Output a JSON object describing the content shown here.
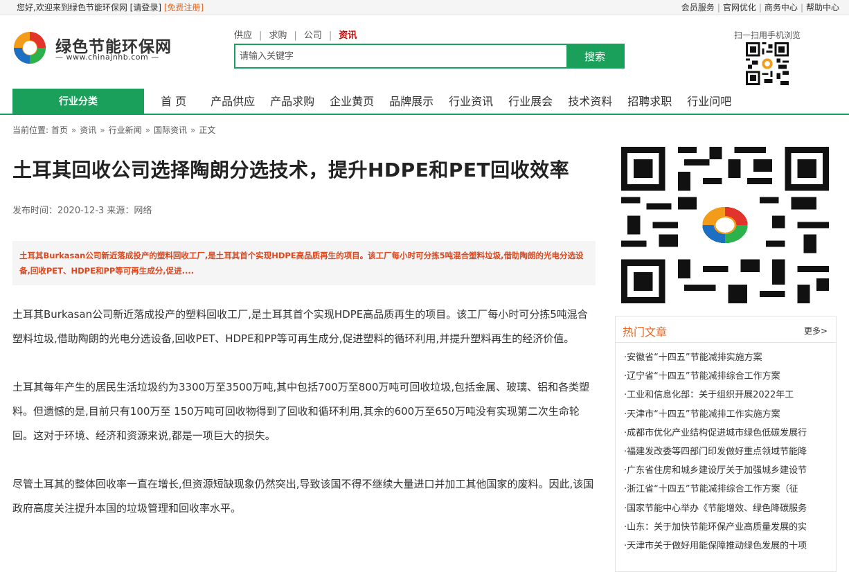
{
  "topbar": {
    "welcome": "您好,欢迎来到绿色节能环保网",
    "login": "[请登录]",
    "register": "[免费注册]",
    "links": [
      "会员服务",
      "官网优化",
      "商务中心",
      "帮助中心"
    ],
    "separator": "|"
  },
  "logo": {
    "name": "绿色节能环保网",
    "url_text": "— www.chinajnhb.com —"
  },
  "search": {
    "tabs": [
      "供应",
      "求购",
      "公司",
      "资讯"
    ],
    "tab_separator": "|",
    "active_tab": "资讯",
    "placeholder": "请输入关键字",
    "button": "搜索"
  },
  "qr_small_label": "扫一扫用手机浏览",
  "nav": {
    "category": "行业分类",
    "items": [
      "首 页",
      "产品供应",
      "产品求购",
      "企业黄页",
      "品牌展示",
      "行业资讯",
      "行业展会",
      "技术资料",
      "招聘求职",
      "行业问吧"
    ]
  },
  "breadcrumb": {
    "prefix": "当前位置:",
    "items": [
      "首页",
      "资讯",
      "行业新闻",
      "国际资讯",
      "正文"
    ],
    "arrow": "»"
  },
  "article": {
    "title": "土耳其回收公司选择陶朗分选技术，提升HDPE和PET回收效率",
    "meta": "发布时间：2020-12-3 来源：网络",
    "summary": "土耳其Burkasan公司新近落成投产的塑料回收工厂,是土耳其首个实现HDPE高品质再生的项目。该工厂每小时可分拣5吨混合塑料垃圾,借助陶朗的光电分选设备,回收PET、HDPE和PP等可再生成分,促进....",
    "paragraphs": [
      "土耳其Burkasan公司新近落成投产的塑料回收工厂,是土耳其首个实现HDPE高品质再生的项目。该工厂每小时可分拣5吨混合塑料垃圾,借助陶朗的光电分选设备,回收PET、HDPE和PP等可再生成分,促进塑料的循环利用,并提升塑料再生的经济价值。",
      "土耳其每年产生的居民生活垃圾约为3300万至3500万吨,其中包括700万至800万吨可回收垃圾,包括金属、玻璃、铝和各类塑料。但遗憾的是,目前只有100万至 150万吨可回收物得到了回收和循环利用,其余的600万至650万吨没有实现第二次生命轮回。这对于环境、经济和资源来说,都是一项巨大的损失。",
      "尽管土耳其的整体回收率一直在增长,但资源短缺现象仍然突出,导致该国不得不继续大量进口并加工其他国家的废料。因此,该国政府高度关注提升本国的垃圾管理和回收率水平。"
    ]
  },
  "hot": {
    "title": "热门文章",
    "more": "更多>",
    "items": [
      "·安徽省“十四五”节能减排实施方案",
      "·辽宁省“十四五”节能减排综合工作方案",
      "·工业和信息化部：关于组织开展2022年工",
      "·天津市“十四五”节能减排工作实施方案",
      "·成都市优化产业结构促进城市绿色低碳发展行",
      "·福建发改委等四部门印发做好重点领域节能降",
      "·广东省住房和城乡建设厅关于加强城乡建设节",
      "·浙江省“十四五”节能减排综合工作方案（征",
      "·国家节能中心举办《节能增效、绿色降碳服务",
      "·山东：关于加快节能环保产业高质量发展的实",
      "·天津市关于做好用能保障推动绿色发展的十项"
    ]
  },
  "colors": {
    "brand_green": "#1aa05a",
    "accent_orange": "#e8661d",
    "summary_red": "#e0461c",
    "active_tab_red": "#cc0000"
  }
}
